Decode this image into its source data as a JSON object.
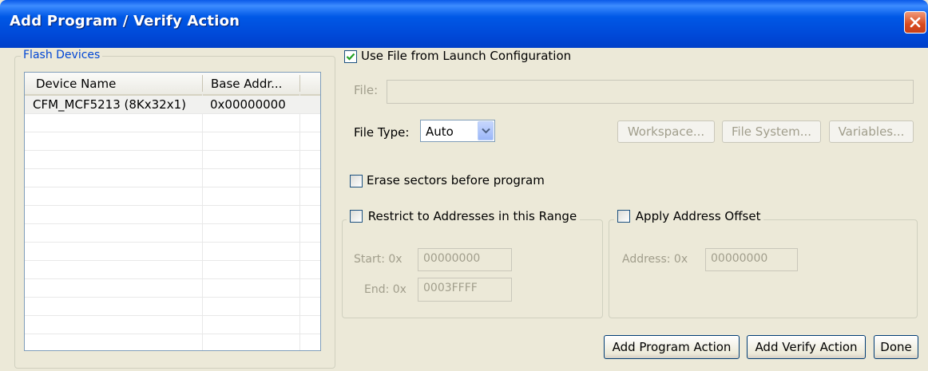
{
  "window": {
    "title": "Add Program / Verify Action"
  },
  "flash_devices": {
    "legend": "Flash Devices",
    "columns": [
      "Device Name",
      "Base Addr..."
    ],
    "rows": [
      {
        "device_name": "CFM_MCF5213 (8Kx32x1)",
        "base_addr": "0x00000000"
      }
    ]
  },
  "launch_config": {
    "label": "Use File from Launch Configuration",
    "checked": true
  },
  "file": {
    "label": "File:",
    "value": ""
  },
  "file_type": {
    "label": "File Type:",
    "value": "Auto"
  },
  "buttons": {
    "workspace": "Workspace...",
    "file_system": "File System...",
    "variables": "Variables...",
    "add_program": "Add Program Action",
    "add_verify": "Add Verify Action",
    "done": "Done"
  },
  "erase": {
    "label": "Erase sectors before program",
    "checked": false
  },
  "restrict": {
    "label": "Restrict to Addresses in this Range",
    "checked": false,
    "start_label": "Start: 0x",
    "start_value": "00000000",
    "end_label": "End: 0x",
    "end_value": "0003FFFF"
  },
  "offset": {
    "label": "Apply Address Offset",
    "checked": false,
    "address_label": "Address: 0x",
    "address_value": "00000000"
  }
}
